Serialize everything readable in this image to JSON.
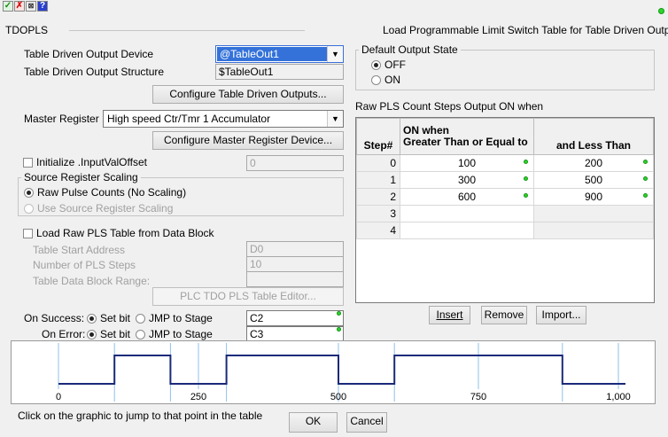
{
  "toolbar": {
    "check_icon": "check-icon",
    "x_icon": "close-icon",
    "help_icon": "help-icon"
  },
  "header": {
    "name": "TDOPLS",
    "description": "Load Programmable Limit Switch Table for Table Driven Output"
  },
  "left": {
    "output_device_label": "Table Driven Output Device",
    "output_device_value": "@TableOut1",
    "output_structure_label": "Table Driven Output Structure",
    "output_structure_value": "$TableOut1",
    "configure_outputs_button": "Configure Table Driven Outputs...",
    "master_register_label": "Master Register",
    "master_register_value": "High speed Ctr/Tmr 1 Accumulator",
    "configure_master_button": "Configure Master Register Device...",
    "init_offset_label": "Initialize .InputValOffset",
    "init_offset_value": "0",
    "scaling_group_label": "Source Register Scaling",
    "scaling_raw_label": "Raw Pulse Counts (No Scaling)",
    "scaling_source_label": "Use Source Register Scaling",
    "load_from_block_label": "Load Raw PLS Table from Data Block",
    "table_start_label": "Table Start Address",
    "table_start_value": "D0",
    "num_steps_label": "Number of PLS Steps",
    "num_steps_value": "10",
    "block_range_label": "Table Data Block Range:",
    "editor_button": "PLC TDO PLS Table Editor...",
    "on_success_label": "On Success:",
    "on_error_label": "On Error:",
    "set_bit_label": "Set bit",
    "jmp_label": "JMP to Stage",
    "success_value": "C2",
    "error_value": "C3"
  },
  "right": {
    "default_state_label": "Default Output State",
    "off_label": "OFF",
    "on_label": "ON",
    "table_title": "Raw PLS Count Steps Output  ON  when",
    "col_step": "Step#",
    "col_on_line1": "ON when",
    "col_on_line2": "Greater Than or Equal to",
    "col_less": "and Less Than",
    "rows": [
      {
        "step": "0",
        "ge": "100",
        "lt": "200"
      },
      {
        "step": "1",
        "ge": "300",
        "lt": "500"
      },
      {
        "step": "2",
        "ge": "600",
        "lt": "900"
      },
      {
        "step": "3",
        "ge": "",
        "lt": ""
      },
      {
        "step": "4",
        "ge": "",
        "lt": ""
      }
    ],
    "insert_button": "Insert",
    "remove_button": "Remove",
    "import_button": "Import..."
  },
  "graph": {
    "ticks": [
      "0",
      "250",
      "500",
      "750",
      "1,000"
    ],
    "hint": "Click on the graphic to jump to that point in the table",
    "steps": [
      [
        100,
        200
      ],
      [
        300,
        500
      ],
      [
        600,
        900
      ]
    ],
    "max": 1000,
    "line_color": "#1a2a7a"
  },
  "footer": {
    "ok": "OK",
    "cancel": "Cancel"
  },
  "colors": {
    "status_dot": "#2bd62b",
    "selection": "#3472d9"
  }
}
